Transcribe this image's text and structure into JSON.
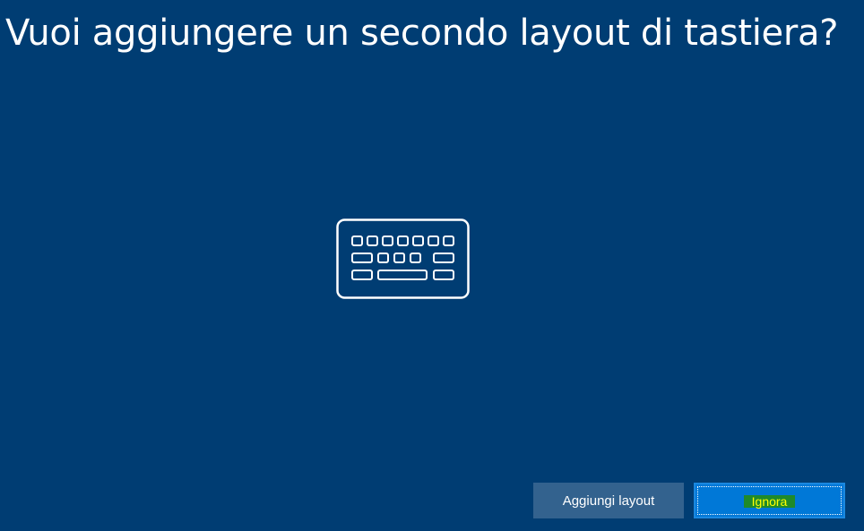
{
  "page": {
    "title": "Vuoi aggiungere un secondo layout di tastiera?"
  },
  "icon": {
    "name": "keyboard-icon"
  },
  "buttons": {
    "add_layout_label": "Aggiungi layout",
    "skip_label": "Ignora"
  },
  "colors": {
    "background": "#003d73",
    "secondary_button": "#33628e",
    "primary_button": "#0078d7",
    "highlight_text": "#ffff00",
    "highlight_background": "#1f8a2a"
  }
}
